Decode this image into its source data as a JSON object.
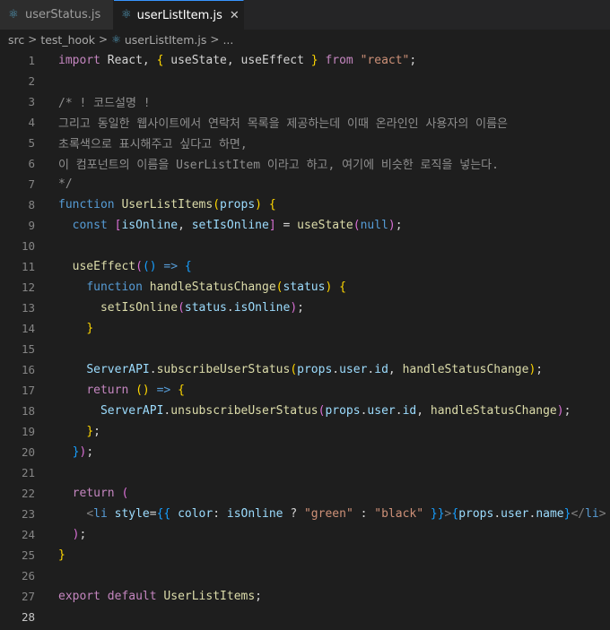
{
  "tabs": [
    {
      "label": "userStatus.js",
      "active": false,
      "icon": "react-js-icon"
    },
    {
      "label": "userListItem.js",
      "active": true,
      "icon": "react-js-icon",
      "close": "✕"
    }
  ],
  "breadcrumb": {
    "items": [
      "src",
      "test_hook",
      "userListItem.js",
      "..."
    ],
    "separator": ">"
  },
  "editor": {
    "current_line": 28,
    "lines": [
      {
        "n": "1",
        "tokens": [
          [
            "kw2",
            "import"
          ],
          [
            "p",
            " React, "
          ],
          [
            "b1",
            "{"
          ],
          [
            "p",
            " useState, useEffect "
          ],
          [
            "b1",
            "}"
          ],
          [
            "p",
            " "
          ],
          [
            "kw2",
            "from"
          ],
          [
            "p",
            " "
          ],
          [
            "str",
            "\"react\""
          ],
          [
            "p",
            ";"
          ]
        ]
      },
      {
        "n": "2",
        "tokens": []
      },
      {
        "n": "3",
        "tokens": [
          [
            "cm",
            "/* ! 코드설명 !"
          ]
        ]
      },
      {
        "n": "4",
        "tokens": [
          [
            "cm",
            "그리고 동일한 웹사이트에서 연락처 목록을 제공하는데 이때 온라인인 사용자의 이름은"
          ]
        ]
      },
      {
        "n": "5",
        "tokens": [
          [
            "cm",
            "초록색으로 표시해주고 싶다고 하면,"
          ]
        ]
      },
      {
        "n": "6",
        "tokens": [
          [
            "cm",
            "이 컴포넌트의 이름을 UserListItem 이라고 하고, 여기에 비슷한 로직을 넣는다."
          ]
        ]
      },
      {
        "n": "7",
        "tokens": [
          [
            "cm",
            "*/"
          ]
        ]
      },
      {
        "n": "8",
        "tokens": [
          [
            "kw",
            "function"
          ],
          [
            "p",
            " "
          ],
          [
            "fn",
            "UserListItems"
          ],
          [
            "b1",
            "("
          ],
          [
            "var",
            "props"
          ],
          [
            "b1",
            ")"
          ],
          [
            "p",
            " "
          ],
          [
            "b1",
            "{"
          ]
        ]
      },
      {
        "n": "9",
        "tokens": [
          [
            "p",
            "  "
          ],
          [
            "kw",
            "const"
          ],
          [
            "p",
            " "
          ],
          [
            "b2",
            "["
          ],
          [
            "var",
            "isOnline"
          ],
          [
            "p",
            ", "
          ],
          [
            "var",
            "setIsOnline"
          ],
          [
            "b2",
            "]"
          ],
          [
            "p",
            " = "
          ],
          [
            "fn",
            "useState"
          ],
          [
            "b2",
            "("
          ],
          [
            "kw",
            "null"
          ],
          [
            "b2",
            ")"
          ],
          [
            "p",
            ";"
          ]
        ]
      },
      {
        "n": "10",
        "tokens": []
      },
      {
        "n": "11",
        "tokens": [
          [
            "p",
            "  "
          ],
          [
            "fn",
            "useEffect"
          ],
          [
            "b2",
            "("
          ],
          [
            "b3",
            "()"
          ],
          [
            "p",
            " "
          ],
          [
            "kw",
            "=>"
          ],
          [
            "p",
            " "
          ],
          [
            "b3",
            "{"
          ]
        ]
      },
      {
        "n": "12",
        "tokens": [
          [
            "p",
            "    "
          ],
          [
            "kw",
            "function"
          ],
          [
            "p",
            " "
          ],
          [
            "fn",
            "handleStatusChange"
          ],
          [
            "b1",
            "("
          ],
          [
            "var",
            "status"
          ],
          [
            "b1",
            ")"
          ],
          [
            "p",
            " "
          ],
          [
            "b1",
            "{"
          ]
        ]
      },
      {
        "n": "13",
        "tokens": [
          [
            "p",
            "      "
          ],
          [
            "fn",
            "setIsOnline"
          ],
          [
            "b2",
            "("
          ],
          [
            "var",
            "status"
          ],
          [
            "p",
            "."
          ],
          [
            "var",
            "isOnline"
          ],
          [
            "b2",
            ")"
          ],
          [
            "p",
            ";"
          ]
        ]
      },
      {
        "n": "14",
        "tokens": [
          [
            "p",
            "    "
          ],
          [
            "b1",
            "}"
          ]
        ]
      },
      {
        "n": "15",
        "tokens": []
      },
      {
        "n": "16",
        "tokens": [
          [
            "p",
            "    "
          ],
          [
            "var",
            "ServerAPI"
          ],
          [
            "p",
            "."
          ],
          [
            "fn",
            "subscribeUserStatus"
          ],
          [
            "b1",
            "("
          ],
          [
            "var",
            "props"
          ],
          [
            "p",
            "."
          ],
          [
            "var",
            "user"
          ],
          [
            "p",
            "."
          ],
          [
            "var",
            "id"
          ],
          [
            "p",
            ", "
          ],
          [
            "fn",
            "handleStatusChange"
          ],
          [
            "b1",
            ")"
          ],
          [
            "p",
            ";"
          ]
        ]
      },
      {
        "n": "17",
        "tokens": [
          [
            "p",
            "    "
          ],
          [
            "ctl",
            "return"
          ],
          [
            "p",
            " "
          ],
          [
            "b1",
            "()"
          ],
          [
            "p",
            " "
          ],
          [
            "kw",
            "=>"
          ],
          [
            "p",
            " "
          ],
          [
            "b1",
            "{"
          ]
        ]
      },
      {
        "n": "18",
        "tokens": [
          [
            "p",
            "      "
          ],
          [
            "var",
            "ServerAPI"
          ],
          [
            "p",
            "."
          ],
          [
            "fn",
            "unsubscribeUserStatus"
          ],
          [
            "b2",
            "("
          ],
          [
            "var",
            "props"
          ],
          [
            "p",
            "."
          ],
          [
            "var",
            "user"
          ],
          [
            "p",
            "."
          ],
          [
            "var",
            "id"
          ],
          [
            "p",
            ", "
          ],
          [
            "fn",
            "handleStatusChange"
          ],
          [
            "b2",
            ")"
          ],
          [
            "p",
            ";"
          ]
        ]
      },
      {
        "n": "19",
        "tokens": [
          [
            "p",
            "    "
          ],
          [
            "b1",
            "}"
          ],
          [
            "p",
            ";"
          ]
        ]
      },
      {
        "n": "20",
        "tokens": [
          [
            "p",
            "  "
          ],
          [
            "b3",
            "}"
          ],
          [
            "b2",
            ")"
          ],
          [
            "p",
            ";"
          ]
        ]
      },
      {
        "n": "21",
        "tokens": []
      },
      {
        "n": "22",
        "tokens": [
          [
            "p",
            "  "
          ],
          [
            "ctl",
            "return"
          ],
          [
            "p",
            " "
          ],
          [
            "b2",
            "("
          ]
        ]
      },
      {
        "n": "23",
        "tokens": [
          [
            "p",
            "    "
          ],
          [
            "tag",
            "<"
          ],
          [
            "tagn",
            "li"
          ],
          [
            "p",
            " "
          ],
          [
            "attr",
            "style"
          ],
          [
            "p",
            "="
          ],
          [
            "b3",
            "{{"
          ],
          [
            "p",
            " "
          ],
          [
            "var",
            "color"
          ],
          [
            "p",
            ": "
          ],
          [
            "var",
            "isOnline"
          ],
          [
            "p",
            " ? "
          ],
          [
            "str",
            "\"green\""
          ],
          [
            "p",
            " : "
          ],
          [
            "str",
            "\"black\""
          ],
          [
            "p",
            " "
          ],
          [
            "b3",
            "}}"
          ],
          [
            "tag",
            ">"
          ],
          [
            "b3",
            "{"
          ],
          [
            "var",
            "props"
          ],
          [
            "p",
            "."
          ],
          [
            "var",
            "user"
          ],
          [
            "p",
            "."
          ],
          [
            "var",
            "name"
          ],
          [
            "b3",
            "}"
          ],
          [
            "tag",
            "</"
          ],
          [
            "tagn",
            "li"
          ],
          [
            "tag",
            ">"
          ]
        ]
      },
      {
        "n": "24",
        "tokens": [
          [
            "p",
            "  "
          ],
          [
            "b2",
            ")"
          ],
          [
            "p",
            ";"
          ]
        ]
      },
      {
        "n": "25",
        "tokens": [
          [
            "b1",
            "}"
          ]
        ]
      },
      {
        "n": "26",
        "tokens": []
      },
      {
        "n": "27",
        "tokens": [
          [
            "ctl",
            "export"
          ],
          [
            "p",
            " "
          ],
          [
            "ctl",
            "default"
          ],
          [
            "p",
            " "
          ],
          [
            "fn",
            "UserListItems"
          ],
          [
            "p",
            ";"
          ]
        ]
      },
      {
        "n": "28",
        "tokens": []
      }
    ]
  },
  "colors": {
    "background": "#1e1e1e",
    "tab_active_border": "#3794ff",
    "keyword": "#569cd6",
    "control": "#c586c0",
    "function": "#dcdcaa",
    "variable": "#9cdcfe",
    "string": "#ce9178",
    "comment": "#8f8f8f",
    "bracket_1": "#ffd700",
    "bracket_2": "#da70d6",
    "bracket_3": "#179fff"
  }
}
